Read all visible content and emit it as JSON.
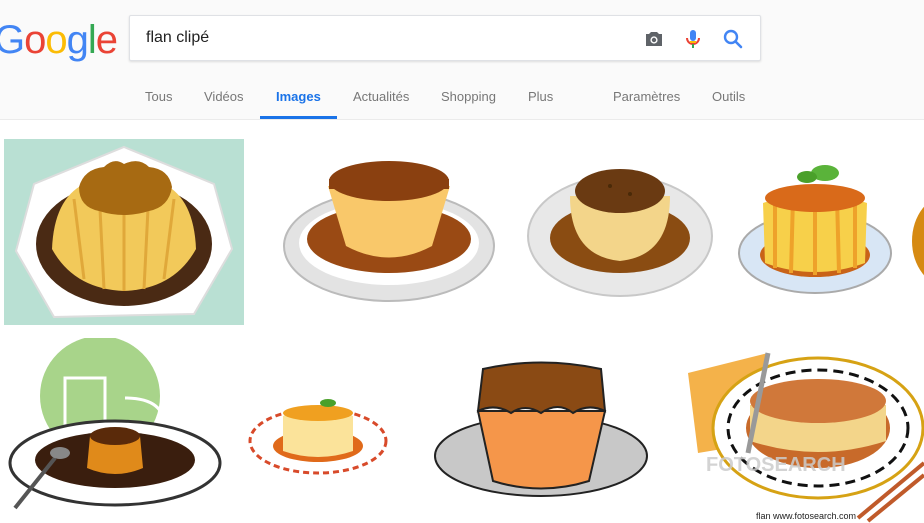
{
  "logo": {
    "letters": [
      "G",
      "o",
      "o",
      "g",
      "l",
      "e"
    ],
    "colors": [
      "#4285f4",
      "#ea4335",
      "#fbbc05",
      "#4285f4",
      "#34a853",
      "#ea4335"
    ]
  },
  "search": {
    "query": "flan clipé"
  },
  "icons": {
    "camera": "camera-icon",
    "mic": "microphone-icon",
    "search": "search-icon"
  },
  "tabs": [
    {
      "label": "Tous"
    },
    {
      "label": "Vidéos"
    },
    {
      "label": "Images",
      "active": true
    },
    {
      "label": "Actualités"
    },
    {
      "label": "Shopping"
    },
    {
      "label": "Plus"
    },
    {
      "label": "Paramètres"
    },
    {
      "label": "Outils"
    }
  ],
  "results": {
    "watermark_1": "FOTOSEARCH",
    "caption_8": "flan  www.fotosearch.com"
  },
  "colors": {
    "accent": "#1a73e8",
    "tab_text": "#777777"
  }
}
